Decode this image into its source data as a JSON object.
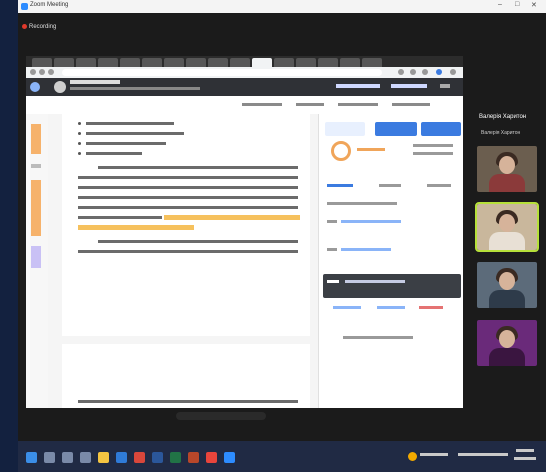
{
  "zoom": {
    "window_title": "Zoom Meeting",
    "recording_label": "Recording"
  },
  "participants": {
    "panel_title": "Валерія Харитон",
    "tiles": [
      {
        "name": "Валерія Харитон"
      },
      {
        "name": ""
      },
      {
        "name": ""
      },
      {
        "name": ""
      }
    ]
  },
  "colors": {
    "accent_blue": "#2d8cff",
    "highlight": "#f6c15d",
    "dark_panel": "#1b1b1b",
    "taskbar": "#202a44"
  },
  "icons": [
    "zoom-icon",
    "record-icon",
    "minimize-icon",
    "maximize-icon",
    "close-icon",
    "windows-start-icon",
    "search-icon",
    "chrome-icon"
  ]
}
